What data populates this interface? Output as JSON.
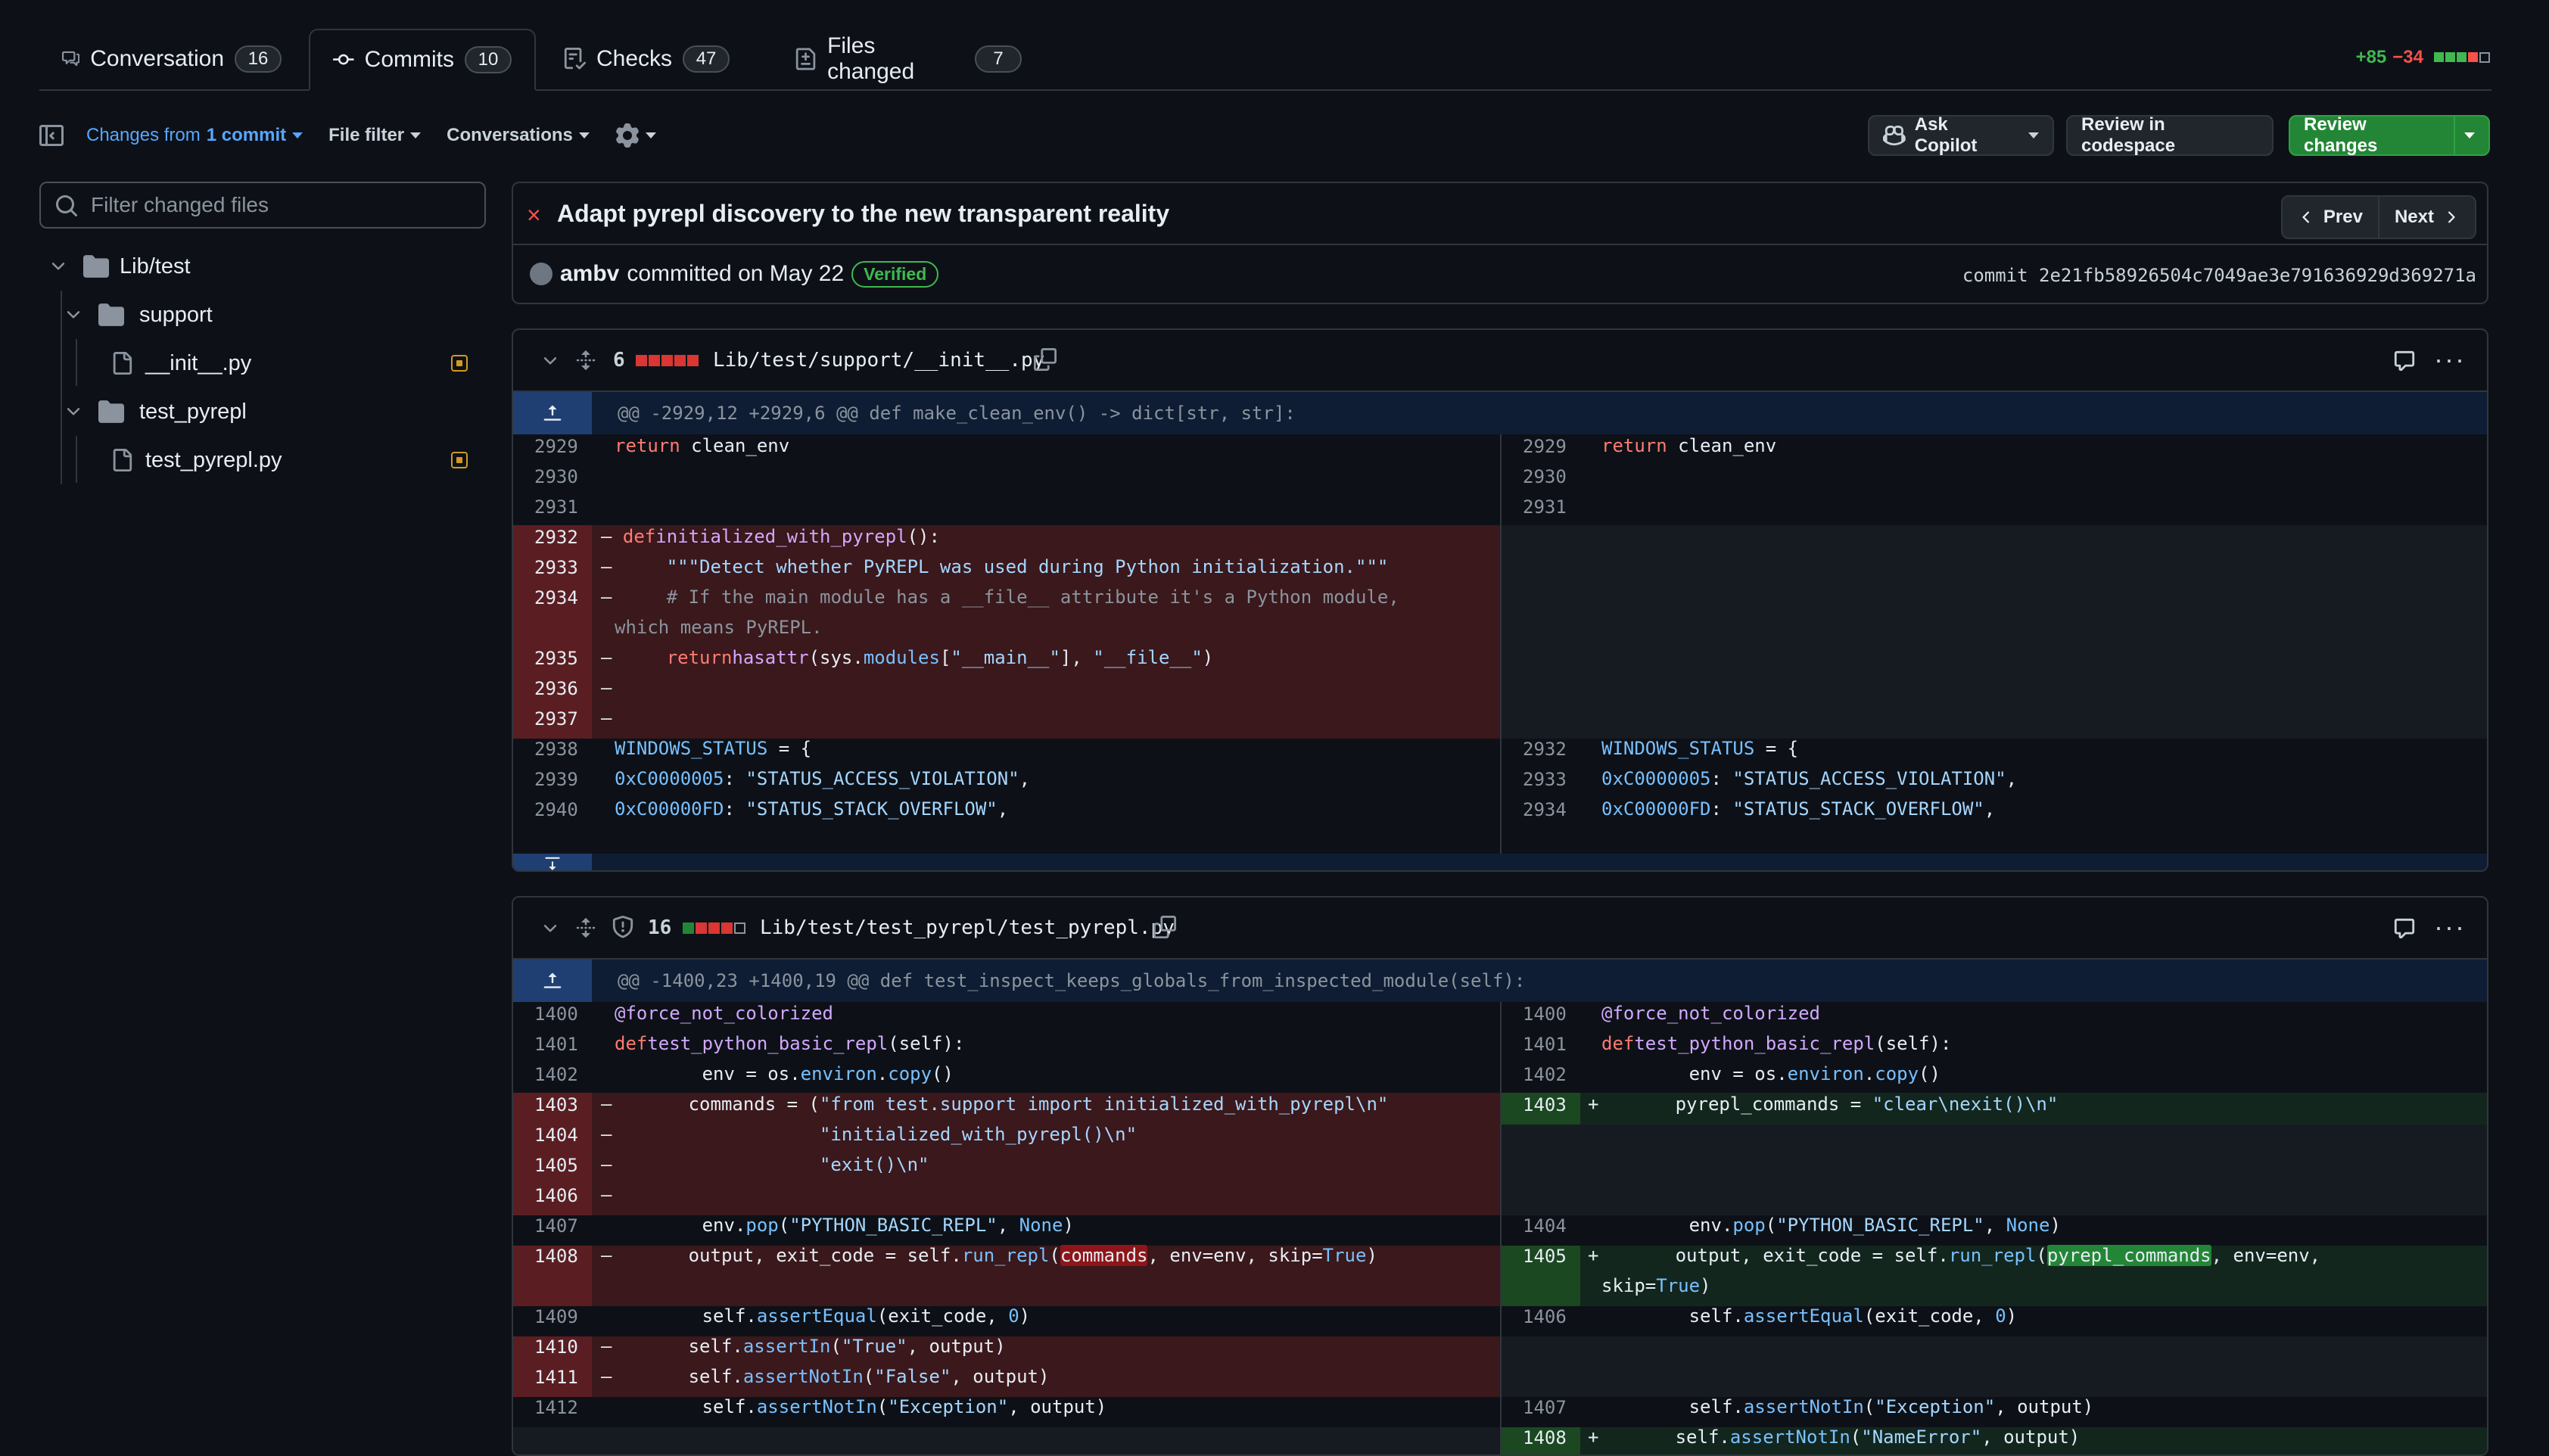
{
  "tabs": [
    {
      "label": "Conversation",
      "count": "16"
    },
    {
      "label": "Commits",
      "count": "10"
    },
    {
      "label": "Checks",
      "count": "47"
    },
    {
      "label": "Files changed",
      "count": "7"
    }
  ],
  "diffstat": {
    "added": "+85",
    "removed": "−34"
  },
  "toolbar": {
    "changes_prefix": "Changes from",
    "changes_value": "1 commit",
    "file_filter": "File filter",
    "conversations": "Conversations",
    "ask_copilot": "Ask Copilot",
    "review_codespace": "Review in codespace",
    "review_changes": "Review changes"
  },
  "sidebar": {
    "filter_placeholder": "Filter changed files",
    "tree": [
      {
        "label": "Lib/test",
        "type": "folder"
      },
      {
        "label": "support",
        "type": "folder"
      },
      {
        "label": "__init__.py",
        "type": "file"
      },
      {
        "label": "test_pyrepl",
        "type": "folder"
      },
      {
        "label": "test_pyrepl.py",
        "type": "file"
      }
    ]
  },
  "commit": {
    "title": "Adapt pyrepl discovery to the new transparent reality",
    "prev": "Prev",
    "next": "Next",
    "author": "ambv",
    "committed_text": "committed on May 22",
    "verified": "Verified",
    "sha": "commit 2e21fb58926504c7049ae3e791636929d369271a"
  },
  "files": [
    {
      "changes": "6",
      "path": "Lib/test/support/__init__.py",
      "hunk": "@@ -2929,12 +2929,6 @@ def make_clean_env() -> dict[str, str]:"
    },
    {
      "changes": "16",
      "path": "Lib/test/test_pyrepl/test_pyrepl.py",
      "hunk": "@@ -1400,23 +1400,19 @@ def test_inspect_keeps_globals_from_inspected_module(self):"
    }
  ],
  "colors": {
    "bg": "#0d1117",
    "border": "#30363d",
    "accent": "#58a6ff",
    "add_bg": "#12261e",
    "del_bg": "#3a181b",
    "green_button": "#238636"
  }
}
